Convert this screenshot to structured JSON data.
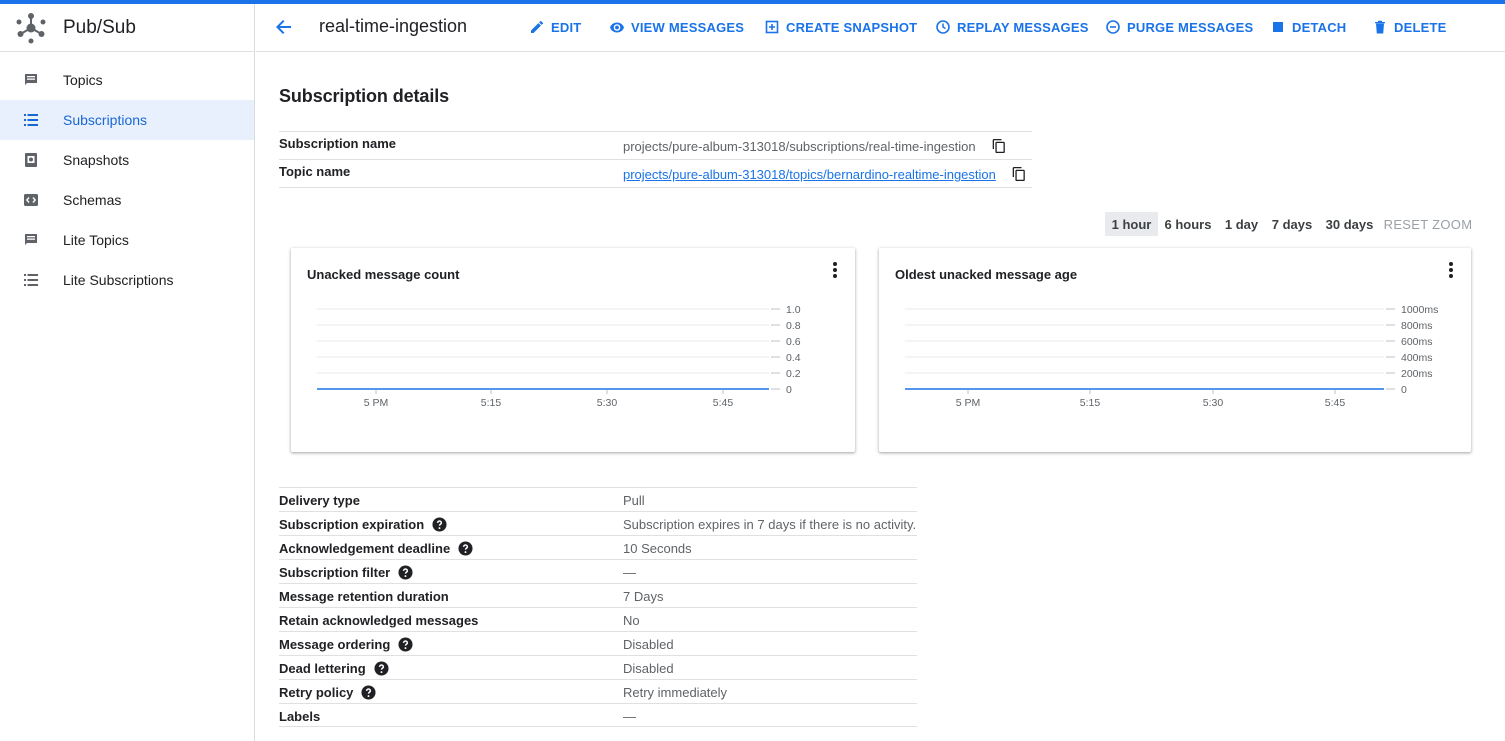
{
  "app": {
    "title": "Pub/Sub",
    "accent": "#1a73e8"
  },
  "sidebar": {
    "items": [
      {
        "label": "Topics",
        "icon": "topic-icon",
        "active": false
      },
      {
        "label": "Subscriptions",
        "icon": "list-icon",
        "active": true
      },
      {
        "label": "Snapshots",
        "icon": "snapshot-icon",
        "active": false
      },
      {
        "label": "Schemas",
        "icon": "schema-icon",
        "active": false
      },
      {
        "label": "Lite Topics",
        "icon": "topic-icon",
        "active": false
      },
      {
        "label": "Lite Subscriptions",
        "icon": "list-icon",
        "active": false
      }
    ]
  },
  "header": {
    "title": "real-time-ingestion",
    "actions": [
      {
        "label": "EDIT",
        "icon": "pencil-icon"
      },
      {
        "label": "VIEW MESSAGES",
        "icon": "eye-icon"
      },
      {
        "label": "CREATE SNAPSHOT",
        "icon": "add-box-icon"
      },
      {
        "label": "REPLAY MESSAGES",
        "icon": "clock-icon"
      },
      {
        "label": "PURGE MESSAGES",
        "icon": "minus-circle-icon"
      },
      {
        "label": "DETACH",
        "icon": "stop-icon"
      },
      {
        "label": "DELETE",
        "icon": "trash-icon"
      }
    ]
  },
  "main": {
    "section_title": "Subscription details",
    "subscription_name_label": "Subscription name",
    "subscription_name": "projects/pure-album-313018/subscriptions/real-time-ingestion",
    "topic_name_label": "Topic name",
    "topic_name": "projects/pure-album-313018/topics/bernardino-realtime-ingestion",
    "zoom": {
      "options": [
        "1 hour",
        "6 hours",
        "1 day",
        "7 days",
        "30 days"
      ],
      "selected": "1 hour",
      "reset": "RESET ZOOM"
    },
    "details": [
      {
        "label": "Delivery type",
        "value": "Pull",
        "help": false
      },
      {
        "label": "Subscription expiration",
        "value": "Subscription expires in 7 days if there is no activity.",
        "help": true
      },
      {
        "label": "Acknowledgement deadline",
        "value": "10 Seconds",
        "help": true
      },
      {
        "label": "Subscription filter",
        "value": "—",
        "help": true
      },
      {
        "label": "Message retention duration",
        "value": "7 Days",
        "help": false
      },
      {
        "label": "Retain acknowledged messages",
        "value": "No",
        "help": false
      },
      {
        "label": "Message ordering",
        "value": "Disabled",
        "help": true
      },
      {
        "label": "Dead lettering",
        "value": "Disabled",
        "help": true
      },
      {
        "label": "Retry policy",
        "value": "Retry immediately",
        "help": true
      },
      {
        "label": "Labels",
        "value": "—",
        "help": false
      }
    ]
  },
  "chart_data": [
    {
      "type": "line",
      "title": "Unacked message count",
      "x": [
        "5 PM",
        "5:15",
        "5:30",
        "5:45"
      ],
      "yticks": [
        "0",
        "0.2",
        "0.4",
        "0.6",
        "0.8",
        "1.0"
      ],
      "ylim": [
        0,
        1
      ],
      "series": [
        {
          "values": [
            0,
            0,
            0,
            0
          ],
          "color": "#1a73e8"
        }
      ],
      "grid": true
    },
    {
      "type": "line",
      "title": "Oldest unacked message age",
      "x": [
        "5 PM",
        "5:15",
        "5:30",
        "5:45"
      ],
      "yticks": [
        "0",
        "200ms",
        "400ms",
        "600ms",
        "800ms",
        "1000ms"
      ],
      "ylim": [
        0,
        1000
      ],
      "series": [
        {
          "values": [
            0,
            0,
            0,
            0
          ],
          "color": "#1a73e8"
        }
      ],
      "grid": true
    }
  ]
}
